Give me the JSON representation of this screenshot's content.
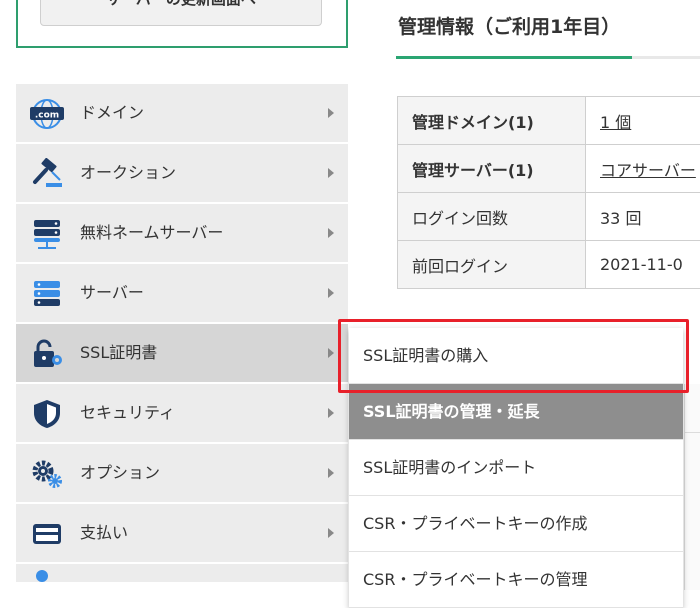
{
  "top_button": {
    "label": "サーバーの更新画面へ"
  },
  "sidebar": {
    "items": [
      {
        "label": "ドメイン",
        "icon": "domain-com-icon",
        "active": false
      },
      {
        "label": "オークション",
        "icon": "auction-gavel-icon",
        "active": false
      },
      {
        "label": "無料ネームサーバー",
        "icon": "name-server-icon",
        "active": false
      },
      {
        "label": "サーバー",
        "icon": "server-icon",
        "active": false
      },
      {
        "label": "SSL証明書",
        "icon": "ssl-lock-icon",
        "active": true
      },
      {
        "label": "セキュリティ",
        "icon": "shield-icon",
        "active": false
      },
      {
        "label": "オプション",
        "icon": "gear-icon",
        "active": false
      },
      {
        "label": "支払い",
        "icon": "credit-card-icon",
        "active": false
      }
    ]
  },
  "management_info": {
    "title": "管理情報（ご利用1年目）",
    "rows": [
      {
        "key": "管理ドメイン(1)",
        "value": "1 個",
        "link": true,
        "bold": true
      },
      {
        "key": "管理サーバー(1)",
        "value": "コアサーバー",
        "link": true,
        "bold": true
      },
      {
        "key": "ログイン回数",
        "value": "33 回",
        "link": false,
        "bold": false
      },
      {
        "key": "前回ログイン",
        "value": "2021-11-0",
        "link": false,
        "bold": false
      }
    ]
  },
  "submenu": {
    "items": [
      {
        "label": "SSL証明書の購入",
        "highlighted": false
      },
      {
        "label": "SSL証明書の管理・延長",
        "highlighted": true
      },
      {
        "label": "SSL証明書のインポート",
        "highlighted": false
      },
      {
        "label": "CSR・プライベートキーの作成",
        "highlighted": false
      },
      {
        "label": "CSR・プライベートキーの管理",
        "highlighted": false
      }
    ]
  },
  "colors": {
    "accent_green": "#2aa572",
    "annotation_red": "#e8202a",
    "icon_navy": "#1f3c66",
    "icon_blue": "#3a8ee6"
  }
}
